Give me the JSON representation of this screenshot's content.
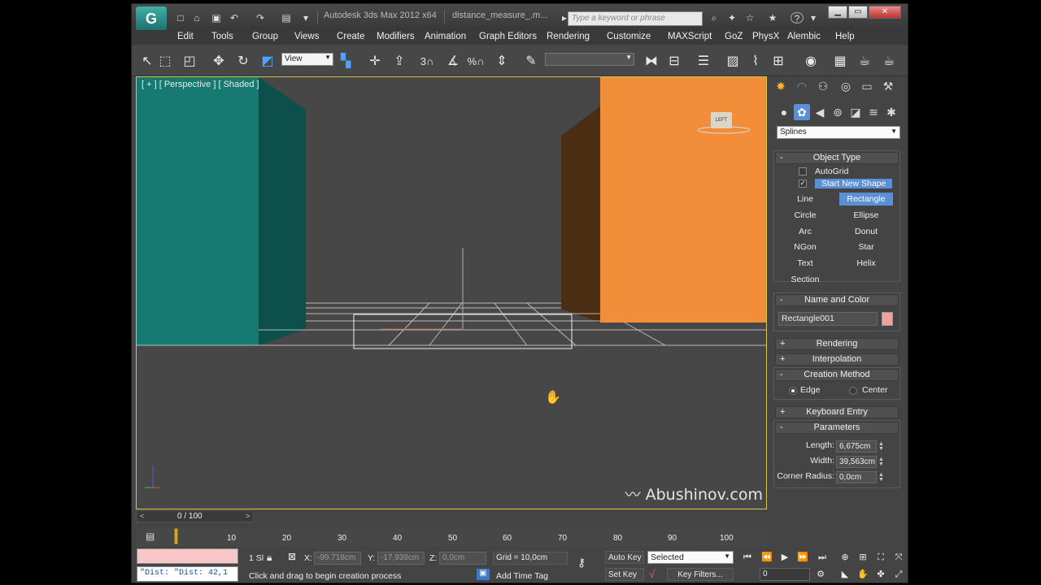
{
  "titlebar": {
    "app_title": "Autodesk 3ds Max  2012 x64",
    "file_title": "distance_measure_.m...",
    "search_placeholder": "Type a keyword or phrase"
  },
  "menu": [
    "Edit",
    "Tools",
    "Group",
    "Views",
    "Create",
    "Modifiers",
    "Animation",
    "Graph Editors",
    "Rendering",
    "Customize",
    "MAXScript",
    "GoZ",
    "PhysX",
    "Alembic",
    "Help"
  ],
  "toolbar": {
    "ref_coord": "View",
    "snap_label": "3",
    "named_selection": ""
  },
  "viewport": {
    "label": "[ + ] [ Perspective ] [ Shaded ]",
    "viewcube_face": "LEFT",
    "watermark": "Abushinov.com",
    "colors": {
      "teal_box": "#167a72",
      "orange_box": "#f28e3a",
      "background": "#474747"
    }
  },
  "command_panel": {
    "category": "Splines",
    "object_type": {
      "title": "Object Type",
      "autogrid": "AutoGrid",
      "start_new_shape": "Start New Shape",
      "buttons": [
        "Line",
        "Rectangle",
        "Circle",
        "Ellipse",
        "Arc",
        "Donut",
        "NGon",
        "Star",
        "Text",
        "Helix",
        "Section"
      ],
      "active": "Rectangle"
    },
    "name_and_color": {
      "title": "Name and Color",
      "name": "Rectangle001",
      "color": "#f0a0a0"
    },
    "rollouts": {
      "rendering": "Rendering",
      "interpolation": "Interpolation",
      "keyboard_entry": "Keyboard Entry"
    },
    "creation_method": {
      "title": "Creation Method",
      "edge": "Edge",
      "center": "Center",
      "selected": "Edge"
    },
    "parameters": {
      "title": "Parameters",
      "length_label": "Length:",
      "length": "6,675cm",
      "width_label": "Width:",
      "width": "39,563cm",
      "corner_label": "Corner Radius:",
      "corner": "0,0cm"
    }
  },
  "timeline": {
    "frame": "0 / 100",
    "ticks": [
      "10",
      "20",
      "30",
      "40",
      "50",
      "60",
      "70",
      "80",
      "90",
      "100"
    ]
  },
  "status": {
    "listener_text": "\"Dist: \"Dist: 42,1",
    "selection": "1 Sl",
    "x_label": "X:",
    "x": "-99,718cm",
    "y_label": "Y:",
    "y": "-17,939cm",
    "z_label": "Z:",
    "z": "0,0cm",
    "grid": "Grid = 10,0cm",
    "auto_key": "Auto Key",
    "selected_set": "Selected",
    "set_key": "Set Key",
    "key_filters": "Key Filters...",
    "prompt": "Click and drag to begin creation process",
    "add_time_tag": "Add Time Tag",
    "current_frame": "0"
  }
}
